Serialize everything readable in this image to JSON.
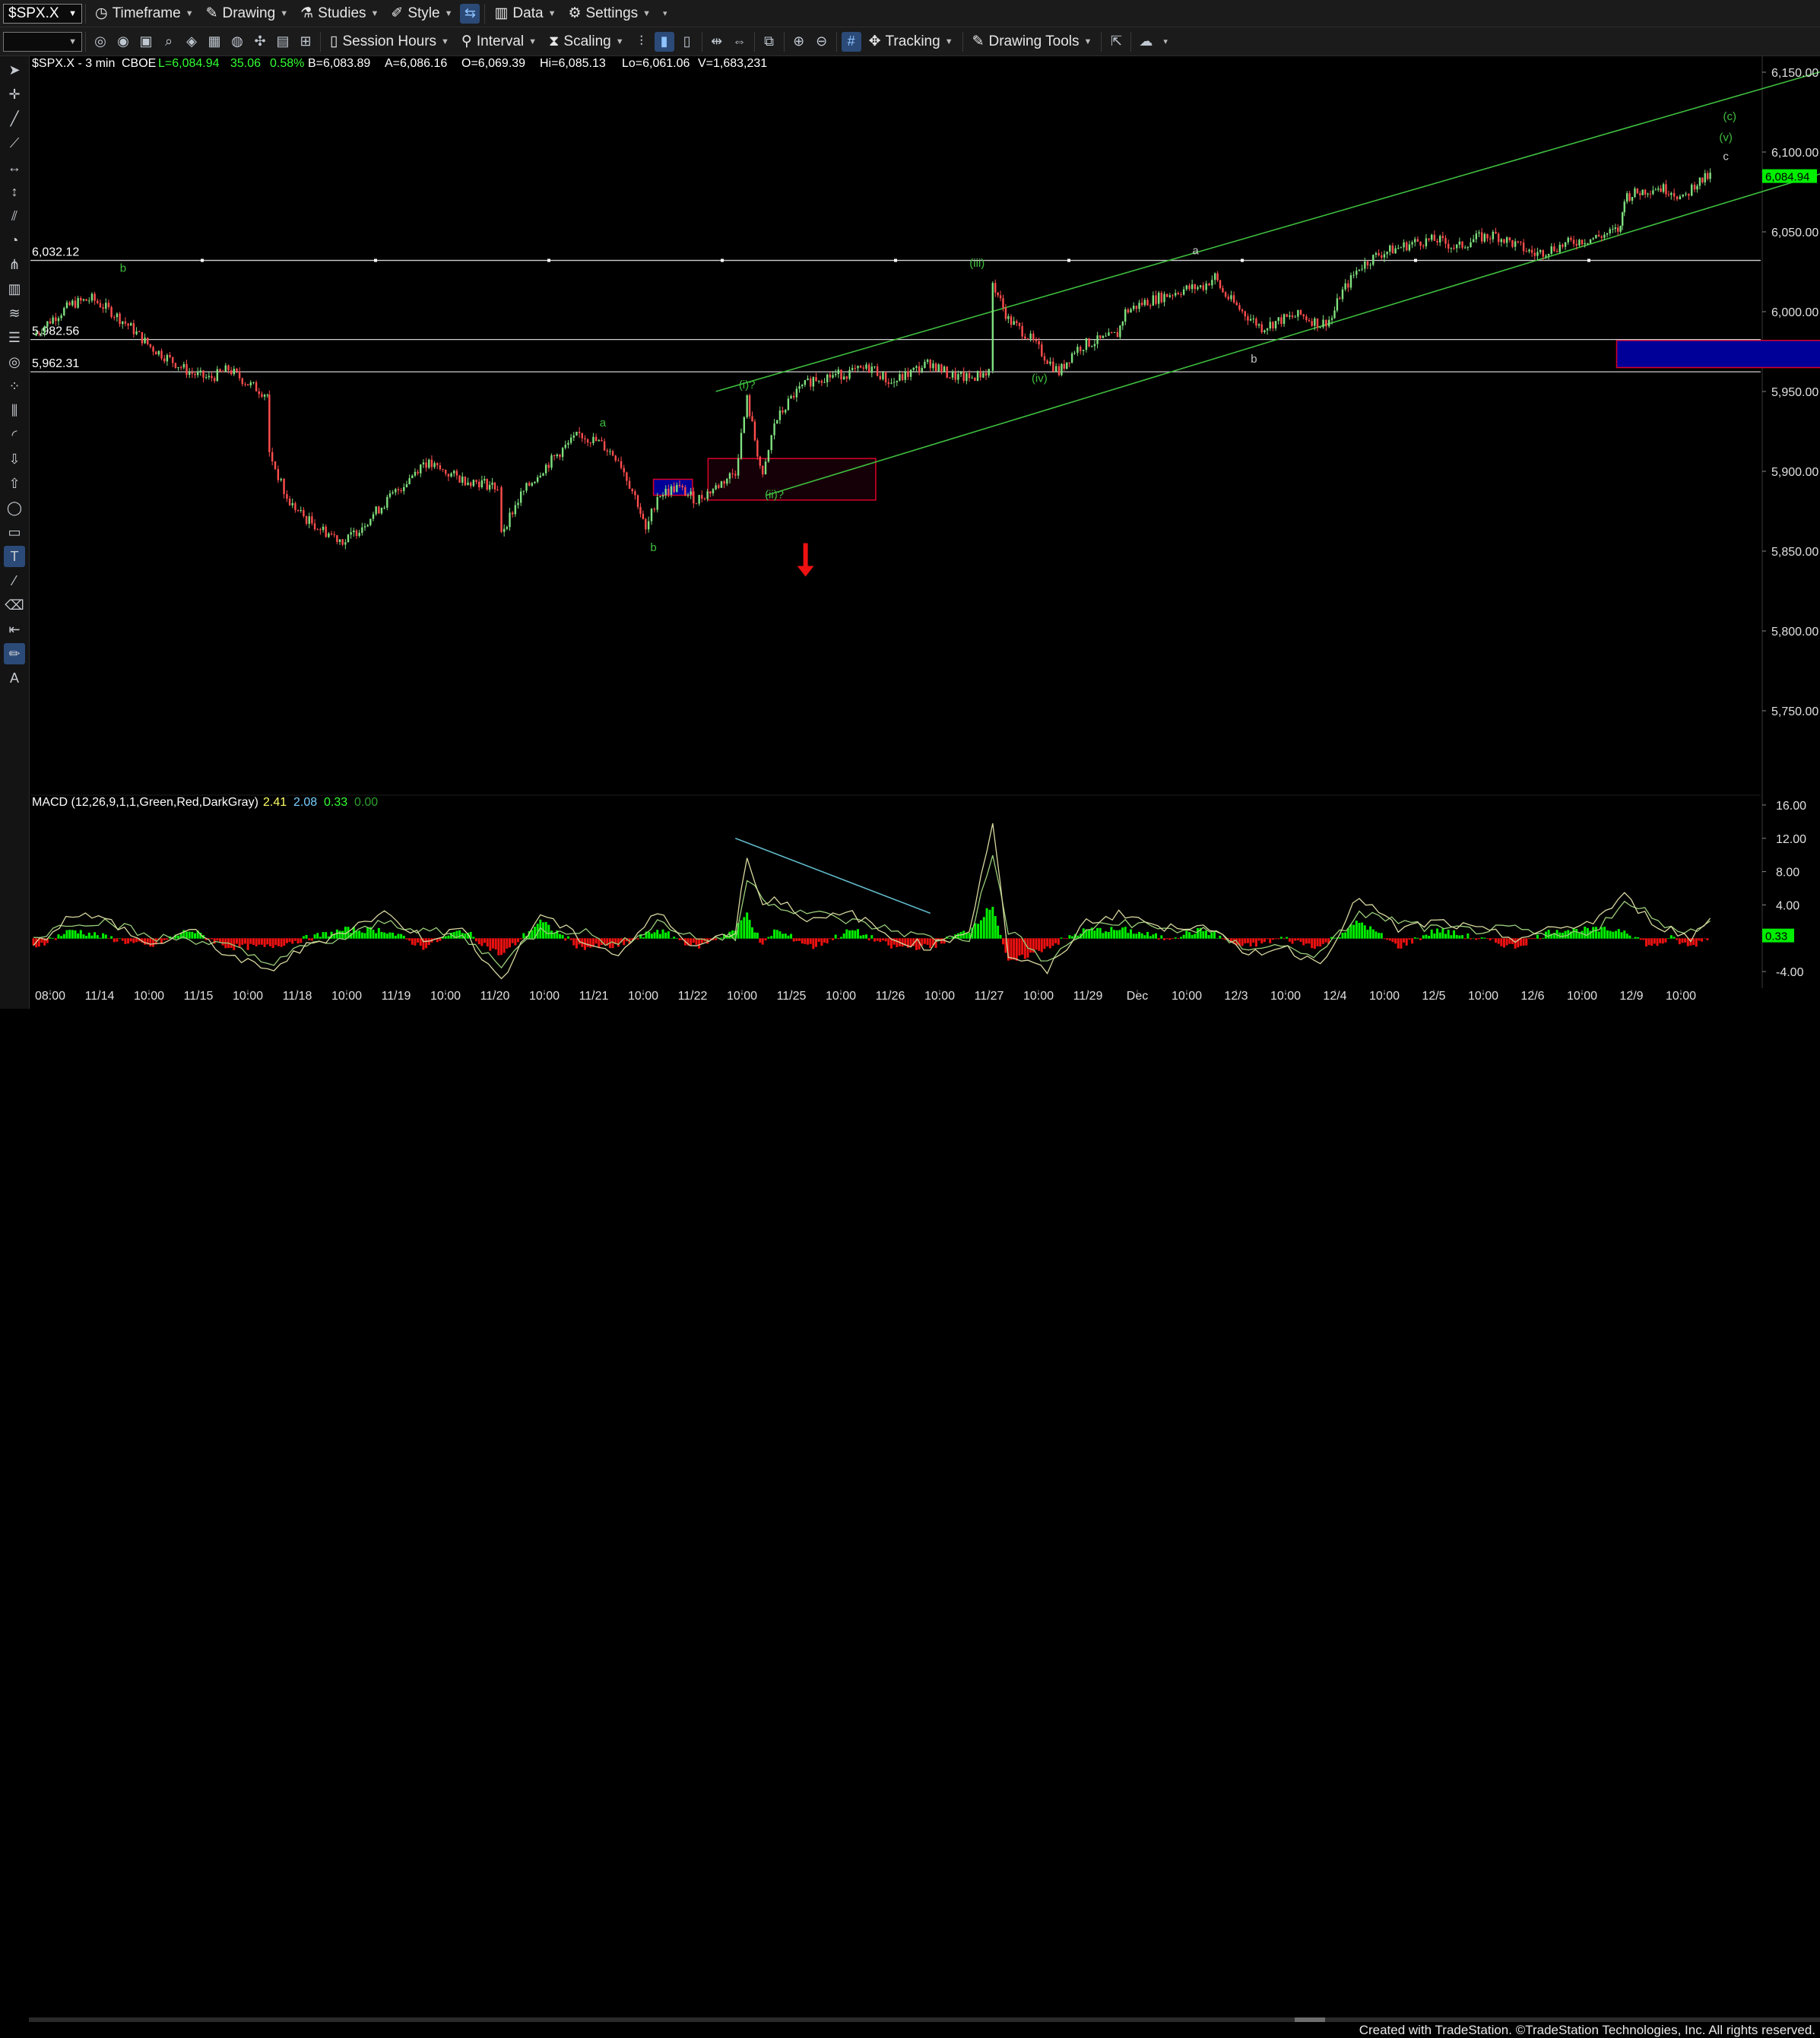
{
  "toolbar1": {
    "symbol": "$SPX.X",
    "items": [
      {
        "label": "Timeframe",
        "icon": "clock-icon"
      },
      {
        "label": "Drawing",
        "icon": "drawing-pen-icon"
      },
      {
        "label": "Studies",
        "icon": "flask-icon"
      },
      {
        "label": "Style",
        "icon": "style-pen-icon"
      },
      {
        "label": "Data",
        "icon": "bar-chart-icon"
      },
      {
        "label": "Settings",
        "icon": "gear-icon"
      }
    ]
  },
  "toolbar2": {
    "items": [
      {
        "label": "Session Hours",
        "icon": "session-icon"
      },
      {
        "label": "Interval",
        "icon": "pin-icon"
      },
      {
        "label": "Scaling",
        "icon": "scaling-icon"
      },
      {
        "label": "Tracking",
        "icon": "tracking-icon"
      },
      {
        "label": "Drawing Tools",
        "icon": "drawing-tools-icon"
      }
    ]
  },
  "header": {
    "title": "$SPX.X - 3 min",
    "exchange": "CBOE",
    "last": "L=6,084.94",
    "change": "35.06",
    "change_pct": "0.58%",
    "bid": "B=6,083.89",
    "ask": "A=6,086.16",
    "open": "O=6,069.39",
    "high": "Hi=6,085.13",
    "low": "Lo=6,061.06",
    "volume": "V=1,683,231"
  },
  "macd_header": {
    "label": "MACD (12,26,9,1,1,Green,Red,DarkGray)",
    "macd": "2.41",
    "signal": "2.08",
    "hist": "0.33",
    "zero": "0.00"
  },
  "credit": "Created with TradeStation. ©TradeStation Technologies, Inc. All rights reserved.",
  "colors": {
    "background": "#000000",
    "up_candle": "#7fe07f",
    "down_candle": "#ff4d4d",
    "channel": "#3fbf3f",
    "wave_label_green": "#3fbf3f",
    "wave_label_gray": "#c8c8c8",
    "horizontal_line": "#d0d0d0",
    "target_box": "#000099",
    "target_box_border": "#d9002a",
    "macd_line": "#d8d8a0",
    "signal_line": "#9acd7a",
    "hist_up": "#00ee00",
    "hist_down": "#ee1111",
    "last_price_tag": "#00ee00",
    "macd_tag": "#00ee00",
    "divergence_line": "#5fb7c8",
    "arrow": "#ee1111"
  },
  "chart_data": [
    {
      "type": "candlestick",
      "title": "$SPX.X - 3 min",
      "ylim": [
        5700,
        6160
      ],
      "y_ticks": [
        "6,150.00",
        "6,100.00",
        "6,050.00",
        "6,000.00",
        "5,950.00",
        "5,900.00",
        "5,850.00",
        "5,800.00",
        "5,750.00"
      ],
      "y_tick_values": [
        6150,
        6100,
        6050,
        6000,
        5950,
        5900,
        5850,
        5800,
        5750
      ],
      "x_ticks": [
        "08:00",
        "11/14",
        "10:00",
        "11/15",
        "10:00",
        "11/18",
        "10:00",
        "11/19",
        "10:00",
        "11/20",
        "10:00",
        "11/21",
        "10:00",
        "11/22",
        "10:00",
        "11/25",
        "10:00",
        "11/26",
        "10:00",
        "11/27",
        "10:00",
        "11/29",
        "Dec",
        "10:00",
        "12/3",
        "10:00",
        "12/4",
        "10:00",
        "12/5",
        "10:00",
        "12/6",
        "10:00",
        "12/9",
        "10:00"
      ],
      "last_price": {
        "label": "6,084.94",
        "value": 6084.94
      },
      "price_path": [
        [
          0.0,
          5985
        ],
        [
          0.5,
          5996
        ],
        [
          1.0,
          6005
        ],
        [
          1.5,
          6008
        ],
        [
          2.0,
          6000
        ],
        [
          2.5,
          5990
        ],
        [
          3.0,
          5978
        ],
        [
          3.5,
          5970
        ],
        [
          4.0,
          5962
        ],
        [
          4.5,
          5958
        ],
        [
          5.0,
          5964
        ],
        [
          5.5,
          5955
        ],
        [
          6.0,
          5948
        ],
        [
          6.05,
          5912
        ],
        [
          6.5,
          5882
        ],
        [
          7.0,
          5870
        ],
        [
          7.5,
          5862
        ],
        [
          8.0,
          5856
        ],
        [
          8.5,
          5868
        ],
        [
          9.0,
          5880
        ],
        [
          9.5,
          5892
        ],
        [
          10.0,
          5906
        ],
        [
          10.5,
          5900
        ],
        [
          11.0,
          5895
        ],
        [
          11.5,
          5893
        ],
        [
          11.9,
          5890
        ],
        [
          12.0,
          5862
        ],
        [
          12.5,
          5885
        ],
        [
          13.0,
          5900
        ],
        [
          13.5,
          5912
        ],
        [
          14.0,
          5923
        ],
        [
          14.5,
          5918
        ],
        [
          15.0,
          5908
        ],
        [
          15.5,
          5880
        ],
        [
          15.7,
          5862
        ],
        [
          16.0,
          5885
        ],
        [
          16.5,
          5890
        ],
        [
          17.0,
          5882
        ],
        [
          17.5,
          5890
        ],
        [
          18.0,
          5900
        ],
        [
          18.3,
          5945
        ],
        [
          18.7,
          5895
        ],
        [
          19.0,
          5930
        ],
        [
          19.5,
          5948
        ],
        [
          20.0,
          5958
        ],
        [
          20.5,
          5960
        ],
        [
          21.0,
          5962
        ],
        [
          21.5,
          5965
        ],
        [
          22.0,
          5955
        ],
        [
          22.5,
          5962
        ],
        [
          23.0,
          5968
        ],
        [
          23.5,
          5960
        ],
        [
          24.0,
          5958
        ],
        [
          24.5,
          5963
        ],
        [
          24.6,
          6018
        ],
        [
          25.0,
          5995
        ],
        [
          25.5,
          5985
        ],
        [
          26.0,
          5970
        ],
        [
          26.3,
          5962
        ],
        [
          26.7,
          5976
        ],
        [
          27.0,
          5980
        ],
        [
          27.5,
          5983
        ],
        [
          27.8,
          5986
        ],
        [
          28.0,
          6000
        ],
        [
          28.5,
          6006
        ],
        [
          29.0,
          6010
        ],
        [
          29.5,
          6014
        ],
        [
          30.0,
          6016
        ],
        [
          30.3,
          6022
        ],
        [
          30.5,
          6012
        ],
        [
          31.0,
          6000
        ],
        [
          31.5,
          5990
        ],
        [
          32.0,
          5995
        ],
        [
          32.5,
          5998
        ],
        [
          33.0,
          5992
        ],
        [
          33.3,
          5996
        ],
        [
          33.5,
          6010
        ],
        [
          34.0,
          6028
        ],
        [
          34.5,
          6036
        ],
        [
          35.0,
          6040
        ],
        [
          35.5,
          6044
        ],
        [
          36.0,
          6045
        ],
        [
          36.5,
          6040
        ],
        [
          37.0,
          6046
        ],
        [
          37.5,
          6048
        ],
        [
          38.0,
          6042
        ],
        [
          38.5,
          6036
        ],
        [
          39.0,
          6040
        ],
        [
          39.5,
          6044
        ],
        [
          40.0,
          6046
        ],
        [
          40.5,
          6050
        ],
        [
          40.7,
          6052
        ],
        [
          40.8,
          6072
        ],
        [
          41.2,
          6075
        ],
        [
          41.6,
          6078
        ],
        [
          42.0,
          6076
        ],
        [
          42.3,
          6070
        ],
        [
          42.6,
          6080
        ],
        [
          43.0,
          6085
        ]
      ],
      "horizontal_lines": [
        {
          "label": "6,032.12",
          "value": 6032.12
        },
        {
          "label": "5,982.56",
          "value": 5982.56
        },
        {
          "label": "5,962.31",
          "value": 5962.31
        }
      ],
      "channel_lines": [
        {
          "from": [
            17.5,
            5950
          ],
          "to": [
            46.5,
            6155
          ]
        },
        {
          "from": [
            18.8,
            5885
          ],
          "to": [
            49.0,
            6110
          ]
        }
      ],
      "target_boxes": [
        {
          "x0": 40.6,
          "x1": 51.3,
          "y0": 5965,
          "y1": 5982,
          "style": "blue"
        },
        {
          "x0": 15.9,
          "x1": 16.9,
          "y0": 5885,
          "y1": 5895,
          "style": "blue"
        },
        {
          "x0": 17.3,
          "x1": 21.6,
          "y0": 5882,
          "y1": 5908,
          "style": "outline"
        }
      ],
      "wave_labels": [
        {
          "text": "b",
          "x": 2.3,
          "y": 6025,
          "color": "green"
        },
        {
          "text": "a",
          "x": 14.6,
          "y": 5928,
          "color": "green"
        },
        {
          "text": "b",
          "x": 15.9,
          "y": 5850,
          "color": "green"
        },
        {
          "text": "(i)?",
          "x": 18.3,
          "y": 5952,
          "color": "green"
        },
        {
          "text": "(ii)?",
          "x": 19.0,
          "y": 5883,
          "color": "green"
        },
        {
          "text": "(iii)",
          "x": 24.2,
          "y": 6028,
          "color": "green"
        },
        {
          "text": "(iv)",
          "x": 25.8,
          "y": 5956,
          "color": "green"
        },
        {
          "text": "a",
          "x": 29.8,
          "y": 6036,
          "color": "gray"
        },
        {
          "text": "b",
          "x": 31.3,
          "y": 5968,
          "color": "gray"
        },
        {
          "text": "(c)",
          "x": 43.5,
          "y": 6120,
          "color": "green"
        },
        {
          "text": "(v)",
          "x": 43.4,
          "y": 6107,
          "color": "green"
        },
        {
          "text": "c",
          "x": 43.4,
          "y": 6095,
          "color": "gray"
        }
      ],
      "arrow": {
        "x": 19.8,
        "y_top": 5855,
        "y_bottom": 5835,
        "direction": "down"
      }
    },
    {
      "type": "line",
      "title": "MACD (12,26,9,1,1,Green,Red,DarkGray)",
      "ylim": [
        -6,
        17
      ],
      "y_ticks": [
        "16.00",
        "12.00",
        "8.00",
        "4.00",
        "-4.00"
      ],
      "y_tick_values": [
        16,
        12,
        8,
        4,
        -4
      ],
      "current_tag": {
        "label": "0.33",
        "value": 0.33
      },
      "series": [
        {
          "name": "MACD",
          "x": [
            0,
            1,
            2,
            3,
            4,
            5,
            6,
            7,
            8,
            9,
            10,
            11,
            12,
            13,
            14,
            15,
            16,
            17,
            18,
            18.3,
            18.7,
            19,
            20,
            21,
            22,
            23,
            24,
            24.6,
            25,
            26,
            27,
            28,
            29,
            30,
            31,
            32,
            33,
            34,
            35,
            36,
            37,
            38,
            39,
            40,
            40.8,
            41.5,
            42,
            42.5,
            43
          ],
          "values": [
            -1,
            3,
            2,
            -1,
            1,
            -2,
            -4,
            -1,
            1,
            3,
            0,
            1,
            -5,
            3,
            0,
            -2,
            3,
            -1,
            1,
            10,
            4,
            5,
            2,
            3,
            0,
            -1,
            1,
            14,
            -2,
            -4,
            2,
            3,
            1,
            2,
            -2,
            -1,
            -3,
            5,
            1,
            2,
            1,
            0,
            1,
            2,
            5,
            2,
            1,
            0,
            2.41
          ]
        },
        {
          "name": "Signal",
          "x": [
            0,
            1,
            2,
            3,
            4,
            5,
            6,
            7,
            8,
            9,
            10,
            11,
            12,
            13,
            14,
            15,
            16,
            17,
            18,
            18.3,
            18.7,
            19,
            20,
            21,
            22,
            23,
            24,
            24.6,
            25,
            26,
            27,
            28,
            29,
            30,
            31,
            32,
            33,
            34,
            35,
            36,
            37,
            38,
            39,
            40,
            40.8,
            41.5,
            42,
            42.5,
            43
          ],
          "values": [
            0,
            2,
            2,
            0,
            0,
            -1,
            -3,
            -1,
            0,
            2,
            1,
            0,
            -3,
            1,
            1,
            -1,
            2,
            0,
            0,
            7,
            5,
            4,
            3,
            2,
            1,
            0,
            0,
            10,
            1,
            -3,
            1,
            2,
            1,
            1,
            -1,
            -1,
            -2,
            3,
            2,
            1,
            1,
            1,
            0,
            1,
            4,
            3,
            1,
            1,
            2.08
          ]
        },
        {
          "name": "Histogram",
          "x": [
            0,
            1,
            2,
            3,
            4,
            5,
            6,
            7,
            8,
            9,
            10,
            11,
            12,
            13,
            14,
            15,
            16,
            17,
            18,
            18.3,
            18.7,
            19,
            20,
            21,
            22,
            23,
            24,
            24.6,
            25,
            26,
            27,
            28,
            29,
            30,
            31,
            32,
            33,
            34,
            35,
            36,
            37,
            38,
            39,
            40,
            40.8,
            41.5,
            42,
            42.5,
            43
          ],
          "values": [
            -1,
            1,
            0,
            -1,
            1,
            -1,
            -1,
            0,
            1,
            1,
            -1,
            1,
            -2,
            2,
            -1,
            -1,
            1,
            -1,
            1,
            3,
            -1,
            1,
            -1,
            1,
            -1,
            -1,
            1,
            4,
            -3,
            -1,
            1,
            1,
            0,
            1,
            -1,
            0,
            -1,
            2,
            -1,
            1,
            0,
            -1,
            1,
            1,
            1,
            -1,
            0,
            -1,
            0.33
          ]
        }
      ],
      "divergence_line": {
        "from": [
          18.0,
          12
        ],
        "to": [
          23.0,
          3
        ]
      }
    }
  ]
}
